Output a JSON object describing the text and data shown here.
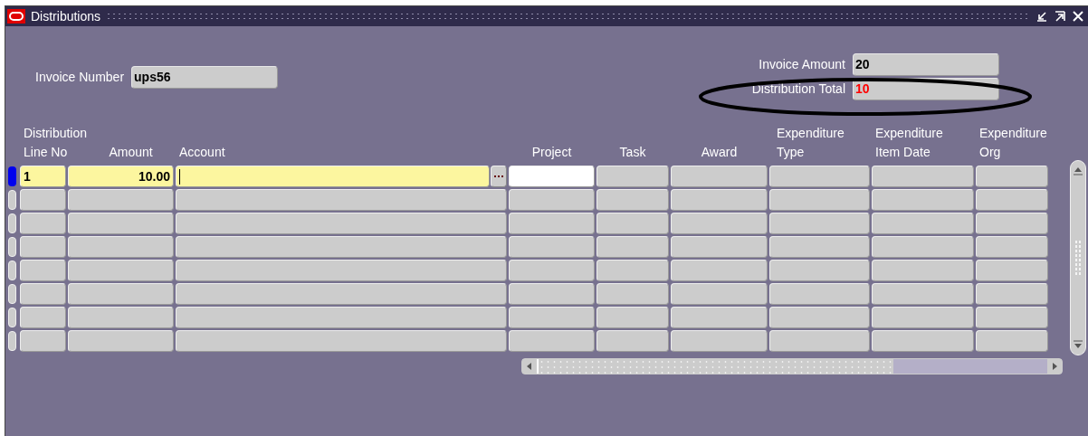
{
  "window": {
    "title": "Distributions"
  },
  "invoice_number": {
    "label": "Invoice Number",
    "value": "ups56"
  },
  "invoice_amount": {
    "label": "Invoice Amount",
    "value": "20"
  },
  "distribution_total": {
    "label": "Distribution Total",
    "value": "10",
    "alert": true,
    "circled": true
  },
  "columns": [
    {
      "lines": [
        "Distribution",
        "Line No"
      ],
      "kind": "required"
    },
    {
      "lines": [
        "Amount"
      ],
      "kind": "required"
    },
    {
      "lines": [
        "Account"
      ],
      "kind": "required",
      "lov": true
    },
    {
      "lines": [
        "Project"
      ],
      "kind": "optional"
    },
    {
      "lines": [
        "Task"
      ],
      "kind": "readonly"
    },
    {
      "lines": [
        "Award"
      ],
      "kind": "readonly"
    },
    {
      "lines": [
        "Expenditure",
        "Type"
      ],
      "kind": "readonly"
    },
    {
      "lines": [
        "Expenditure",
        "Item Date"
      ],
      "kind": "readonly"
    },
    {
      "lines": [
        "Expenditure",
        "Org"
      ],
      "kind": "readonly"
    }
  ],
  "rows": [
    {
      "selected": true,
      "values": [
        "1",
        "10.00"
      ]
    },
    {
      "selected": false
    },
    {
      "selected": false
    },
    {
      "selected": false
    },
    {
      "selected": false
    },
    {
      "selected": false
    },
    {
      "selected": false
    },
    {
      "selected": false
    }
  ]
}
